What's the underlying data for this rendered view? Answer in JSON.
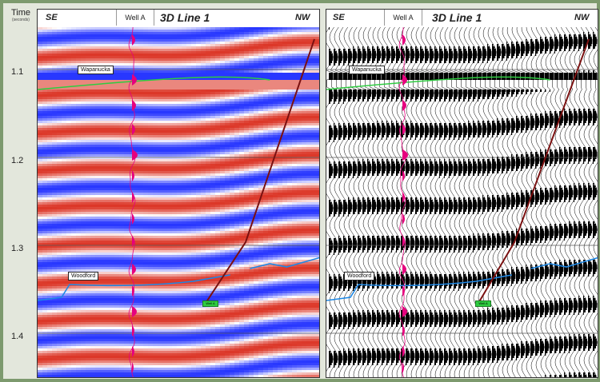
{
  "axis": {
    "title": "Time",
    "unit": "(seconds)",
    "ticks": [
      "1.1",
      "1.2",
      "1.3",
      "1.4"
    ]
  },
  "panels": [
    {
      "id": "left",
      "display": "color amplitude",
      "left_direction": "SE",
      "right_direction": "NW",
      "well_label": "Well A",
      "title": "3D Line 1",
      "horizons": [
        "Wapanucka",
        "Woodford"
      ],
      "well_tag": "Well A"
    },
    {
      "id": "right",
      "display": "variable-area wiggle",
      "left_direction": "SE",
      "right_direction": "NW",
      "well_label": "Well A",
      "title": "3D Line 1",
      "horizons": [
        "Wapanucka",
        "Woodford"
      ],
      "well_tag": "Well A"
    }
  ],
  "colors": {
    "frame": "#7d9a6e",
    "wapanucka": "#2ecc40",
    "woodford": "#1e88e5",
    "well_path": "#7a1010",
    "synthetic": "#e6007e"
  }
}
